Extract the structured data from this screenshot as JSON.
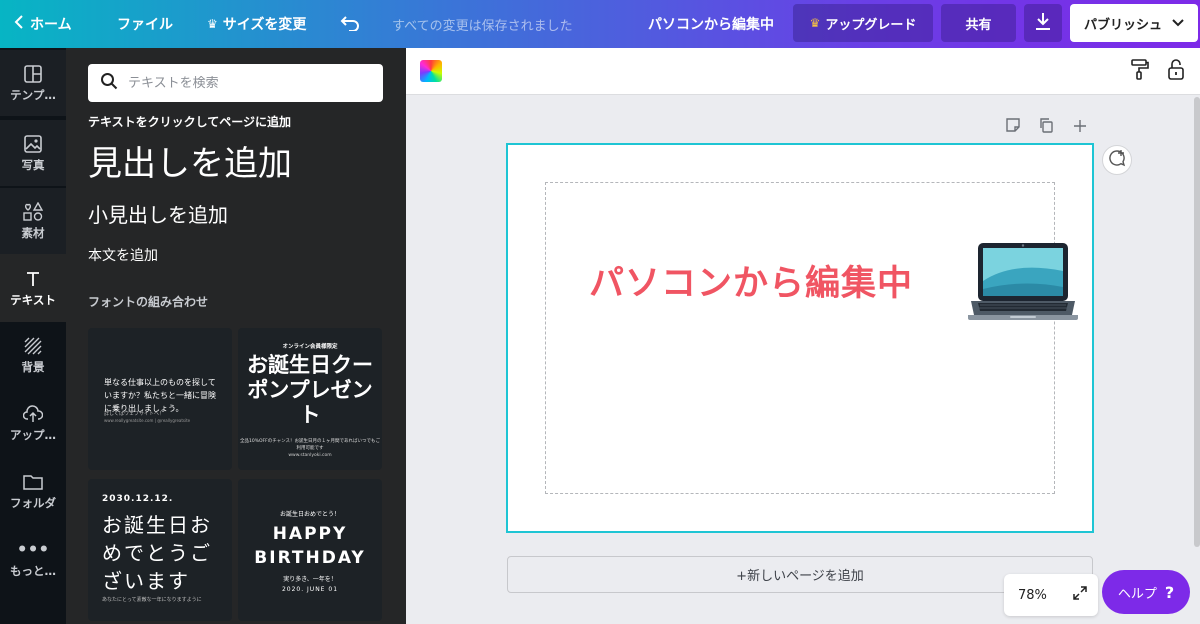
{
  "topbar": {
    "home": "ホーム",
    "file": "ファイル",
    "resize": "サイズを変更",
    "saved_status": "すべての変更は保存されました",
    "doc_title": "パソコンから編集中",
    "upgrade": "アップグレード",
    "share": "共有",
    "publish": "パブリッシュ"
  },
  "rail": {
    "items": [
      {
        "label": "テンプ…",
        "icon": "layout-icon"
      },
      {
        "label": "写真",
        "icon": "photo-icon"
      },
      {
        "label": "素材",
        "icon": "elements-icon"
      },
      {
        "label": "テキスト",
        "icon": "text-icon"
      },
      {
        "label": "背景",
        "icon": "background-icon"
      },
      {
        "label": "アップ…",
        "icon": "upload-icon"
      },
      {
        "label": "フォルダ",
        "icon": "folder-icon"
      },
      {
        "label": "もっと…",
        "icon": "more-icon"
      }
    ]
  },
  "panel": {
    "search_placeholder": "テキストを検索",
    "hint": "テキストをクリックしてページに追加",
    "add_heading": "見出しを追加",
    "add_subheading": "小見出しを追加",
    "add_body": "本文を追加",
    "font_combos": "フォントの組み合わせ",
    "cards": [
      {
        "line1": "単なる仕事以上のものを探していますか？私たちと一緒に冒険に乗り出しましょう。",
        "line2": "詳しくはウェブサイトへ！",
        "line3": "www.reallygreatsite.com | @reallygreatsite"
      },
      {
        "kicker": "オンライン会員様限定",
        "title": "お誕生日クーポンプレゼント",
        "note": "全品10%OFFのチャンス！お誕生日月の１ヶ月間であればいつでもご利用可能です",
        "url": "www.stanlyoki.com"
      },
      {
        "date": "2030.12.12.",
        "title": "お誕生日おめでとうございます",
        "note": "あなたにとって素敵な一年になりますように"
      },
      {
        "kicker": "お誕生日おめでとう！",
        "title": "HAPPY BIRTHDAY",
        "note": "実り多き、一年を！",
        "date": "2020. JUNE 01"
      }
    ]
  },
  "canvas": {
    "title_text": "パソコンから編集中",
    "title_color": "#f05563",
    "add_page": "+新しいページを追加",
    "zoom": "78%",
    "help": "ヘルプ",
    "help_mark": "?"
  },
  "colors": {
    "accent": "#7d2ae8",
    "selection": "#1ec5d4",
    "panel_bg": "#252627"
  }
}
